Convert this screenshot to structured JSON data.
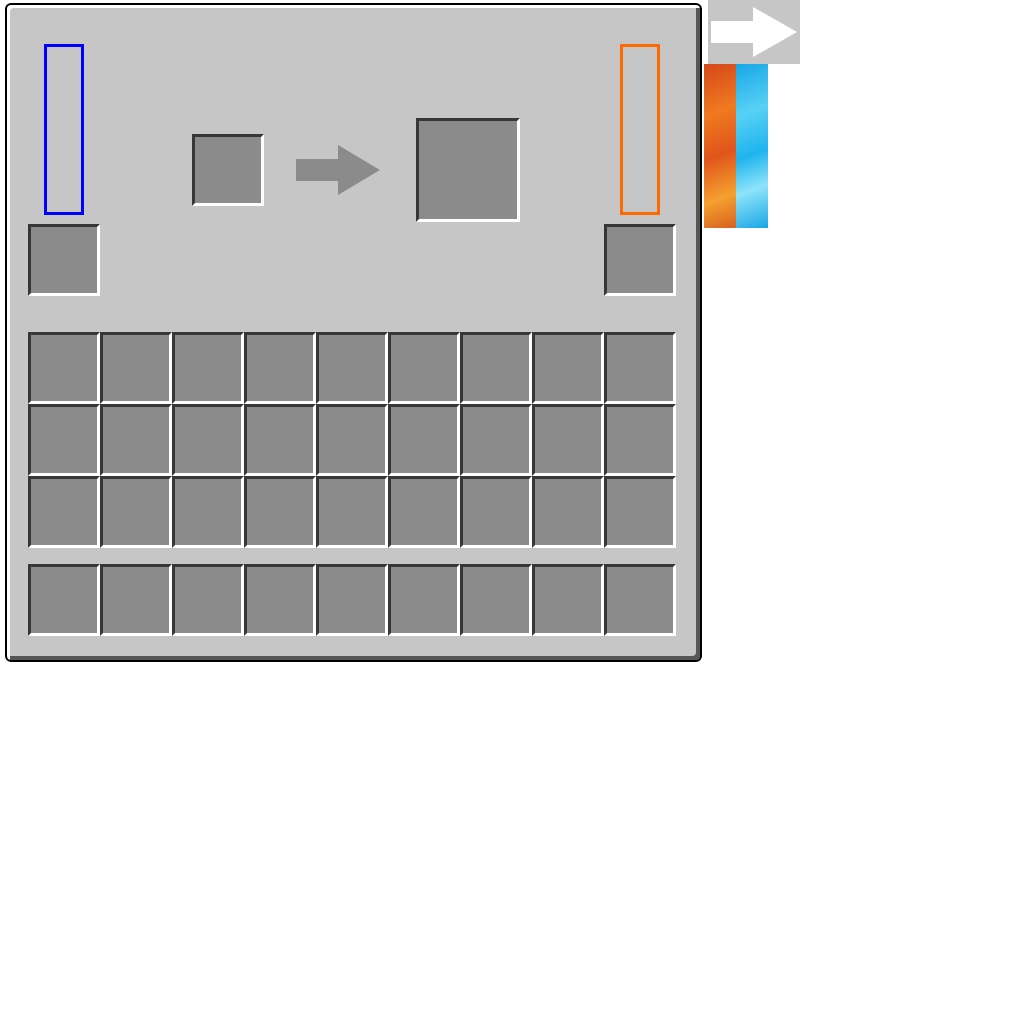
{
  "machine": {
    "progress": 0
  },
  "tanks": [
    {
      "name": "input-tank",
      "level": 0,
      "color": "#0000ff"
    },
    {
      "name": "output-tank",
      "level": 0,
      "color": "#ff6a00"
    }
  ],
  "inventory": {
    "rows": 3,
    "columns": 9
  },
  "hotbar": {
    "slots": 9
  }
}
